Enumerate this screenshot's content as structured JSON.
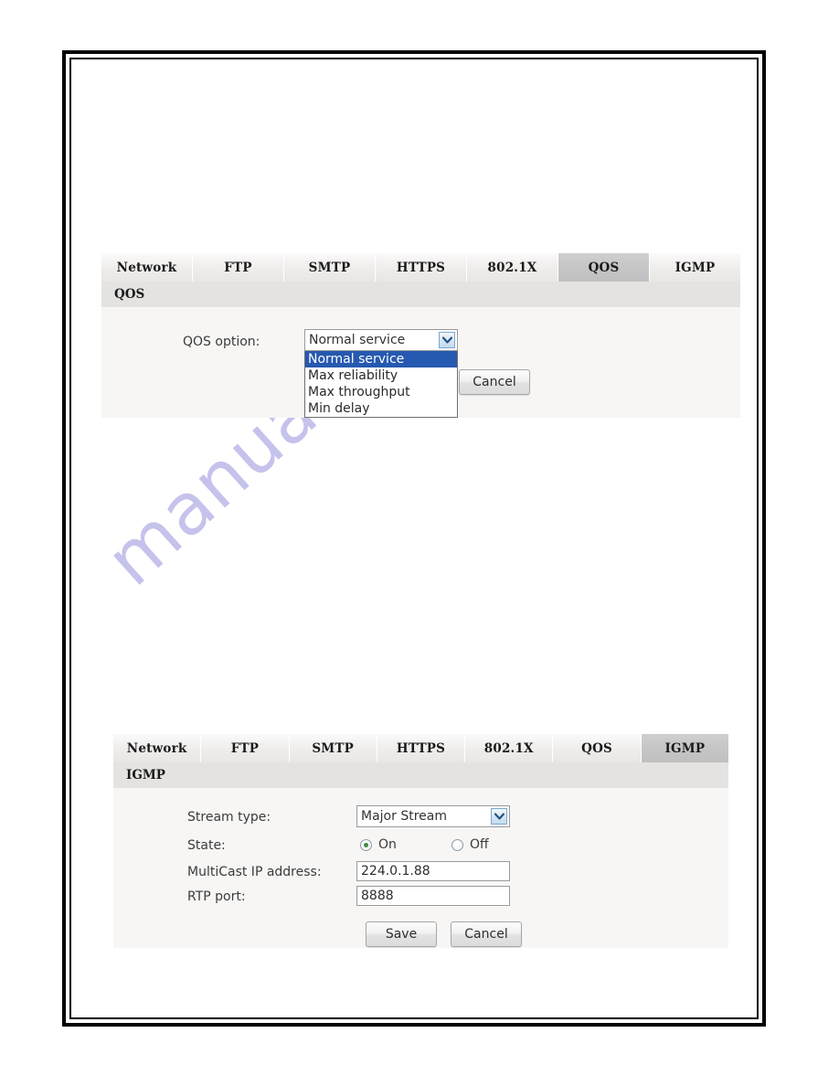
{
  "watermark": {
    "text": "manualshive.com",
    "color": "#c5c2ec"
  },
  "tabs": [
    "Network",
    "FTP",
    "SMTP",
    "HTTPS",
    "802.1X",
    "QOS",
    "IGMP"
  ],
  "qos_panel": {
    "active_tab": "QOS",
    "section_title": "QOS",
    "option_label": "QOS option:",
    "select_value": "Normal service",
    "dropdown_open": true,
    "dropdown_options": [
      "Normal service",
      "Max reliability",
      "Max throughput",
      "Min delay"
    ],
    "selected_option": "Normal service",
    "cancel_label": "Cancel",
    "select_arrow_icon": "chevron-down-icon"
  },
  "igmp_panel": {
    "active_tab": "IGMP",
    "section_title": "IGMP",
    "fields": {
      "stream_type_label": "Stream type:",
      "stream_type_value": "Major Stream",
      "state_label": "State:",
      "state_on_label": "On",
      "state_off_label": "Off",
      "state_value": "On",
      "multicast_label": "MultiCast IP address:",
      "multicast_value": "224.0.1.88",
      "rtp_label": "RTP port:",
      "rtp_value": "8888"
    },
    "save_label": "Save",
    "cancel_label": "Cancel",
    "select_arrow_icon": "chevron-down-icon"
  }
}
